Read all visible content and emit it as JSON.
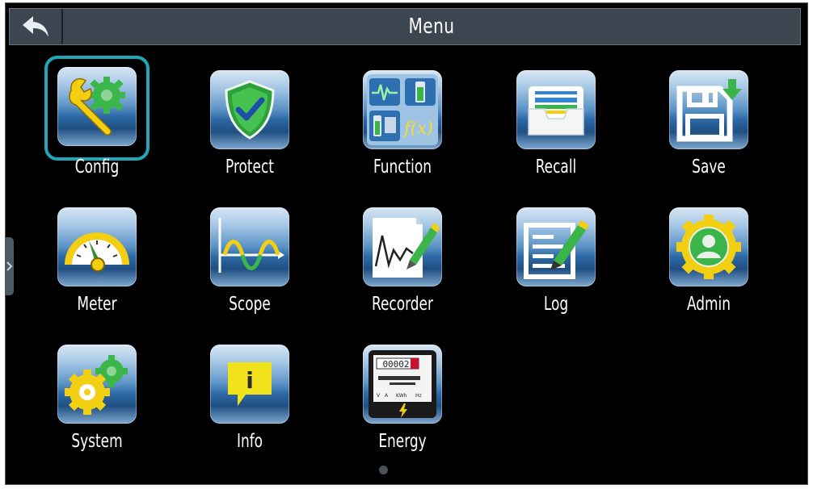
{
  "header": {
    "title": "Menu",
    "back_icon": "back-arrow-icon"
  },
  "menu": [
    {
      "label": "Config",
      "icon": "wrench-gear-icon"
    },
    {
      "label": "Protect",
      "icon": "shield-check-icon"
    },
    {
      "label": "Function",
      "icon": "function-grid-icon",
      "fx_text": "f(x)"
    },
    {
      "label": "Recall",
      "icon": "recall-tray-icon"
    },
    {
      "label": "Save",
      "icon": "floppy-save-icon"
    },
    {
      "label": "Meter",
      "icon": "gauge-meter-icon"
    },
    {
      "label": "Scope",
      "icon": "waveform-scope-icon"
    },
    {
      "label": "Recorder",
      "icon": "recorder-chart-icon"
    },
    {
      "label": "Log",
      "icon": "log-edit-icon"
    },
    {
      "label": "Admin",
      "icon": "admin-user-gear-icon"
    },
    {
      "label": "System",
      "icon": "system-gears-icon"
    },
    {
      "label": "Info",
      "icon": "info-bubble-icon",
      "info_text": "i"
    },
    {
      "label": "Energy",
      "icon": "energy-meter-icon",
      "counter": "00002",
      "units": [
        "V",
        "A",
        "KWh",
        "Hz"
      ]
    }
  ],
  "selected": "Config",
  "pagination": {
    "current": 1,
    "total": 1
  },
  "colors": {
    "background": "#000000",
    "topbar": "#3c4650",
    "selection": "#1fa7b8",
    "text": "#ffffff"
  }
}
